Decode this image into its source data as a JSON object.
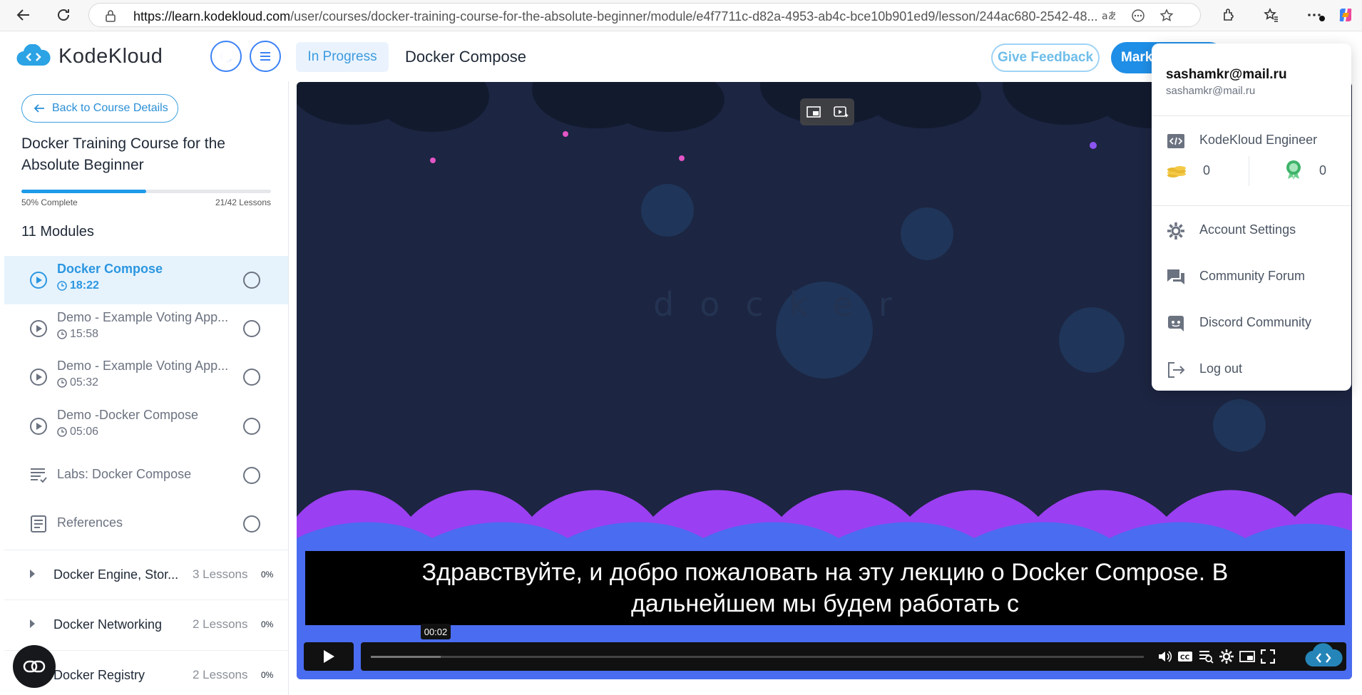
{
  "browser": {
    "url_host": "https://learn.kodekloud.com",
    "url_path": "/user/courses/docker-training-course-for-the-absolute-beginner/module/e4f7711c-d82a-4953-ab4c-bce10b901ed9/lesson/244ac680-2542-48..."
  },
  "header": {
    "logo_text": "KodeKloud",
    "status_label": "In Progress",
    "lesson_title": "Docker Compose",
    "feedback_label": "Give Feedback",
    "mark_label": "Mark"
  },
  "sidebar": {
    "back_label": "Back to Course Details",
    "course_title": "Docker Training Course for the Absolute Beginner",
    "progress_percent": 50,
    "progress_label": "50% Complete",
    "lessons_label": "21/42 Lessons",
    "modules_label": "11 Modules",
    "lessons": [
      {
        "name": "Docker Compose",
        "duration": "18:22",
        "type": "video",
        "active": true
      },
      {
        "name": "Demo - Example Voting App...",
        "duration": "15:58",
        "type": "video",
        "active": false
      },
      {
        "name": "Demo - Example Voting App...",
        "duration": "05:32",
        "type": "video",
        "active": false
      },
      {
        "name": "Demo -Docker Compose",
        "duration": "05:06",
        "type": "video",
        "active": false
      },
      {
        "name": "Labs: Docker Compose",
        "duration": "",
        "type": "lab",
        "active": false
      },
      {
        "name": "References",
        "duration": "",
        "type": "doc",
        "active": false
      }
    ],
    "modules": [
      {
        "name": "Docker Engine, Stor...",
        "count": "3 Lessons",
        "pct": "0%"
      },
      {
        "name": "Docker Networking",
        "count": "2 Lessons",
        "pct": "0%"
      },
      {
        "name": "Docker Registry",
        "count": "2 Lessons",
        "pct": "0%"
      }
    ]
  },
  "video": {
    "subtitle_line1": "Здравствуйте, и добро пожаловать на эту лекцию о Docker Compose. В",
    "subtitle_line2": "дальнейшем мы будем работать с",
    "time_tooltip": "00:02",
    "buffered_fraction": 0.09
  },
  "account_menu": {
    "name": "sashamkr@mail.ru",
    "email": "sashamkr@mail.ru",
    "plan_label": "KodeKloud Engineer",
    "coins": "0",
    "badges": "0",
    "items": [
      {
        "label": "Account Settings",
        "icon": "gear-icon"
      },
      {
        "label": "Community Forum",
        "icon": "forum-icon"
      },
      {
        "label": "Discord Community",
        "icon": "discord-icon"
      },
      {
        "label": "Log out",
        "icon": "logout-icon"
      }
    ]
  },
  "colors": {
    "accent": "#1f8ee6",
    "video_bg": "#1c2541",
    "wave_purple": "#9b3ff2",
    "wave_blue": "#4a6cf0"
  }
}
